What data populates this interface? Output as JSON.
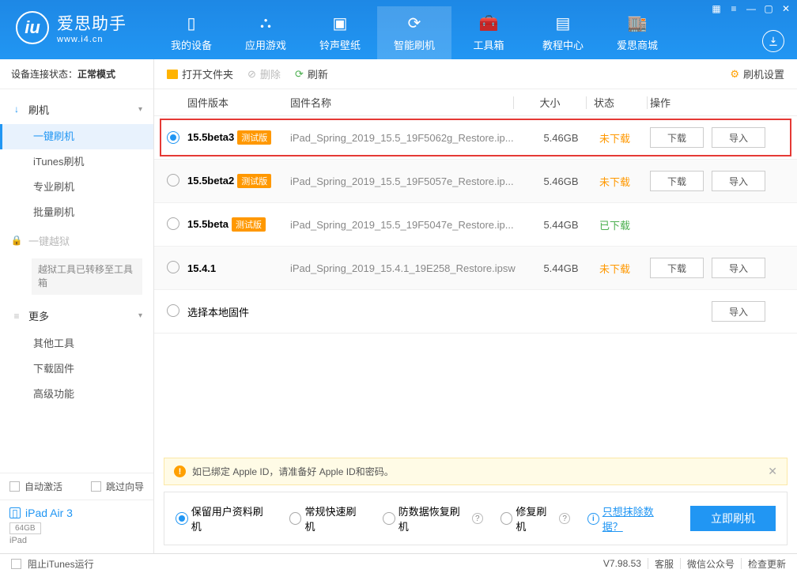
{
  "brand": {
    "name": "爱思助手",
    "site": "www.i4.cn"
  },
  "nav": {
    "items": [
      {
        "label": "我的设备"
      },
      {
        "label": "应用游戏"
      },
      {
        "label": "铃声壁纸"
      },
      {
        "label": "智能刷机"
      },
      {
        "label": "工具箱"
      },
      {
        "label": "教程中心"
      },
      {
        "label": "爱思商城"
      }
    ],
    "active_index": 3
  },
  "sidebar": {
    "conn_label": "设备连接状态：",
    "conn_value": "正常模式",
    "group_flash": {
      "label": "刷机"
    },
    "items_flash": [
      {
        "label": "一键刷机"
      },
      {
        "label": "iTunes刷机"
      },
      {
        "label": "专业刷机"
      },
      {
        "label": "批量刷机"
      }
    ],
    "group_jailbreak": {
      "label": "一键越狱"
    },
    "jailbreak_note": "越狱工具已转移至工具箱",
    "group_more": {
      "label": "更多"
    },
    "items_more": [
      {
        "label": "其他工具"
      },
      {
        "label": "下载固件"
      },
      {
        "label": "高级功能"
      }
    ],
    "auto_activate": "自动激活",
    "skip_guide": "跳过向导"
  },
  "device": {
    "name": "iPad Air 3",
    "storage": "64GB",
    "type": "iPad"
  },
  "toolbar": {
    "open_folder": "打开文件夹",
    "delete": "删除",
    "refresh": "刷新",
    "settings": "刷机设置"
  },
  "columns": {
    "version": "固件版本",
    "name": "固件名称",
    "size": "大小",
    "status": "状态",
    "action": "操作"
  },
  "badges": {
    "beta": "测试版"
  },
  "status_labels": {
    "not_downloaded": "未下载",
    "downloaded": "已下载"
  },
  "actions": {
    "download": "下载",
    "import": "导入"
  },
  "firmware": [
    {
      "version": "15.5beta3",
      "beta": true,
      "name": "iPad_Spring_2019_15.5_19F5062g_Restore.ip...",
      "size": "5.46GB",
      "status": "not_downloaded",
      "selected": true,
      "highlight": true
    },
    {
      "version": "15.5beta2",
      "beta": true,
      "name": "iPad_Spring_2019_15.5_19F5057e_Restore.ip...",
      "size": "5.46GB",
      "status": "not_downloaded"
    },
    {
      "version": "15.5beta",
      "beta": true,
      "name": "iPad_Spring_2019_15.5_19F5047e_Restore.ip...",
      "size": "5.44GB",
      "status": "downloaded"
    },
    {
      "version": "15.4.1",
      "beta": false,
      "name": "iPad_Spring_2019_15.4.1_19E258_Restore.ipsw",
      "size": "5.44GB",
      "status": "not_downloaded"
    }
  ],
  "local_firmware_label": "选择本地固件",
  "alert": {
    "text": "如已绑定 Apple ID，请准备好 Apple ID和密码。"
  },
  "flash_options": {
    "opt_keep": "保留用户资料刷机",
    "opt_normal": "常规快速刷机",
    "opt_recovery": "防数据恢复刷机",
    "opt_repair": "修复刷机",
    "link_erase": "只想抹除数据？",
    "button": "立即刷机"
  },
  "footer": {
    "block_itunes": "阻止iTunes运行",
    "version": "V7.98.53",
    "support": "客服",
    "wechat": "微信公众号",
    "check_update": "检查更新"
  }
}
